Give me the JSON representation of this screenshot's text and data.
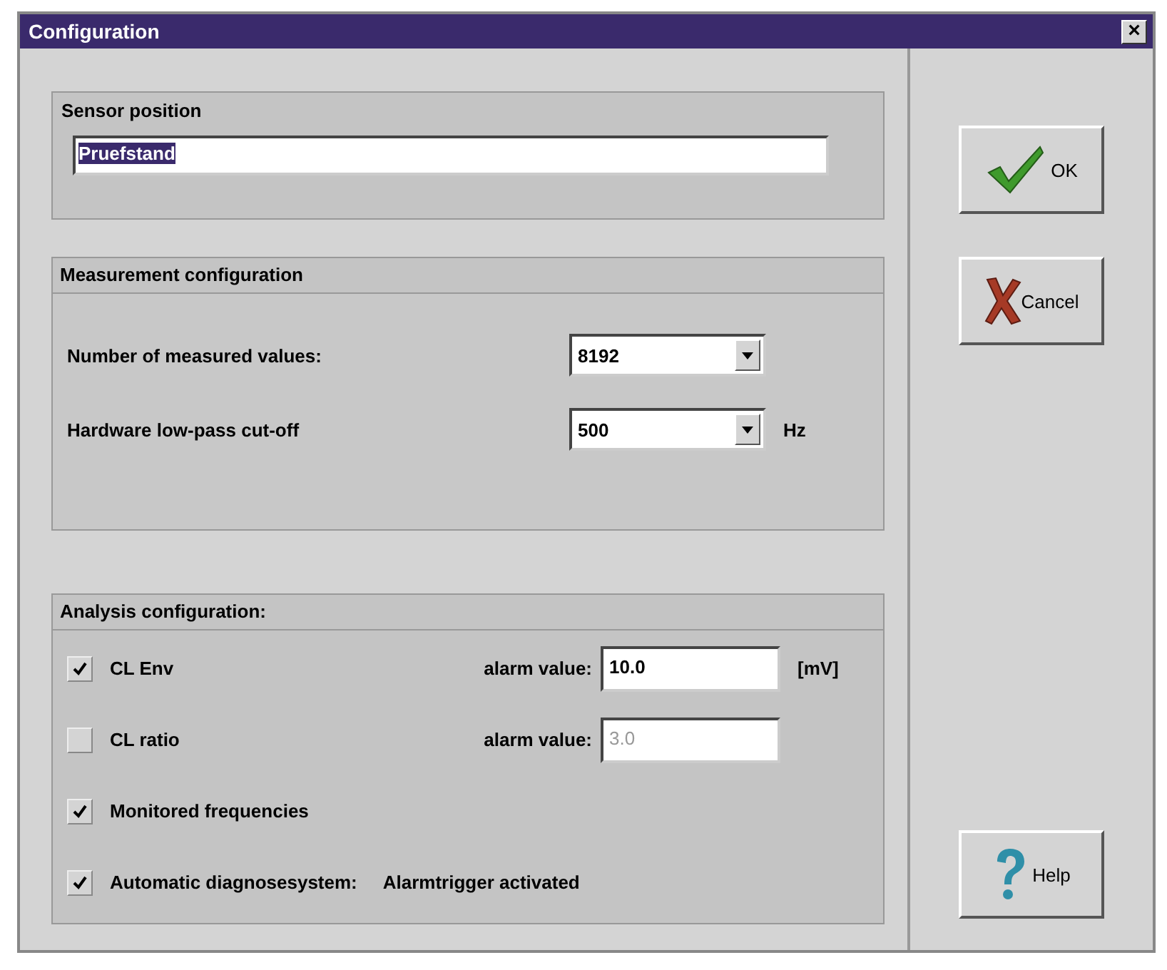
{
  "window": {
    "title": "Configuration",
    "close": "×"
  },
  "sensor": {
    "title": "Sensor position",
    "value": "Pruefstand"
  },
  "measurement": {
    "title": "Measurement configuration",
    "fields": [
      {
        "label": "Number of measured values:",
        "value": "8192"
      },
      {
        "label": "Hardware low-pass cut-off",
        "value": "500",
        "unit": "Hz"
      }
    ]
  },
  "analysis": {
    "title": "Analysis configuration:",
    "rows": [
      {
        "kind": "alarm",
        "label": "CL Env",
        "checked": true,
        "alarm_label": "alarm value:",
        "alarm_value": "10.0",
        "disabled": false,
        "unit": "[mV]"
      },
      {
        "kind": "alarm",
        "label": "CL ratio",
        "checked": false,
        "alarm_label": "alarm value:",
        "alarm_value": "3.0",
        "disabled": true
      },
      {
        "kind": "plain",
        "label": "Monitored frequencies",
        "checked": true
      },
      {
        "kind": "status",
        "label": "Automatic diagnosesystem:",
        "checked": true,
        "status": "Alarmtrigger activated"
      }
    ]
  },
  "buttons": [
    {
      "kind": "ok",
      "label": "OK"
    },
    {
      "kind": "cancel",
      "label": "Cancel"
    },
    {
      "kind": "help",
      "label": "Help"
    }
  ]
}
